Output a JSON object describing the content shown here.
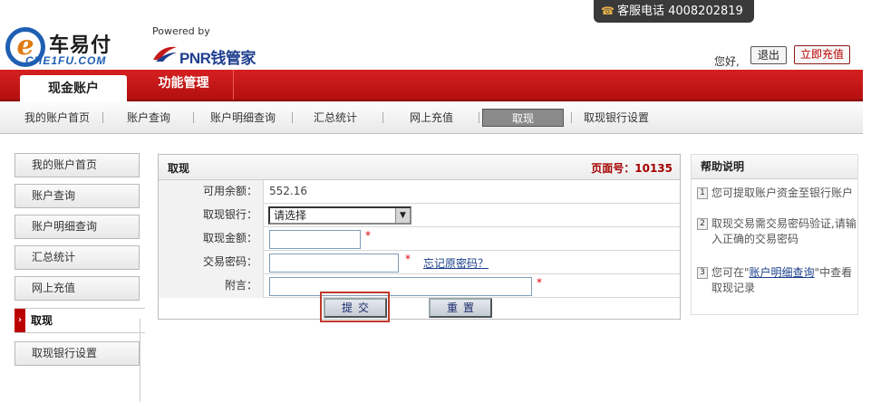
{
  "header": {
    "hotline": "客服电话 4008202819",
    "brand_cn": "车易付",
    "brand_en": "CHE1FU.COM",
    "powered_by": "Powered by",
    "pnr_logo": "PNR钱管家",
    "greeting": "您好,",
    "logout": "退出",
    "topup": "立即充值"
  },
  "main_nav": {
    "active": "现金账户",
    "other": "功能管理"
  },
  "sub_nav": [
    "我的账户首页",
    "账户查询",
    "账户明细查询",
    "汇总统计",
    "网上充值",
    "取现",
    "取现银行设置"
  ],
  "sidebar": [
    "我的账户首页",
    "账户查询",
    "账户明细查询",
    "汇总统计",
    "网上充值",
    "取现",
    "取现银行设置"
  ],
  "form": {
    "title": "取现",
    "page_no": "页面号：10135",
    "balance_label": "可用余额：",
    "balance_value": "552.16",
    "bank_label": "取现银行：",
    "bank_select": "请选择",
    "amount_label": "取现金额：",
    "password_label": "交易密码：",
    "forgot_link": "忘记原密码？",
    "note_label": "附言：",
    "required_mark": "*",
    "submit": "提交",
    "reset": "重置"
  },
  "help": {
    "title": "帮助说明",
    "items": [
      "您可提取账户资金至银行账户",
      "取现交易需交易密码验证,请输入正确的交易密码"
    ],
    "item3_prefix": "您可在\"",
    "item3_link": "账户明细查询",
    "item3_suffix": "\"中查看取现记录",
    "numbers": [
      "1",
      "2",
      "3"
    ]
  },
  "colors": {
    "brand_red": "#c41a1a",
    "link_blue": "#1a3f8a",
    "page_no_red": "#a40000"
  }
}
